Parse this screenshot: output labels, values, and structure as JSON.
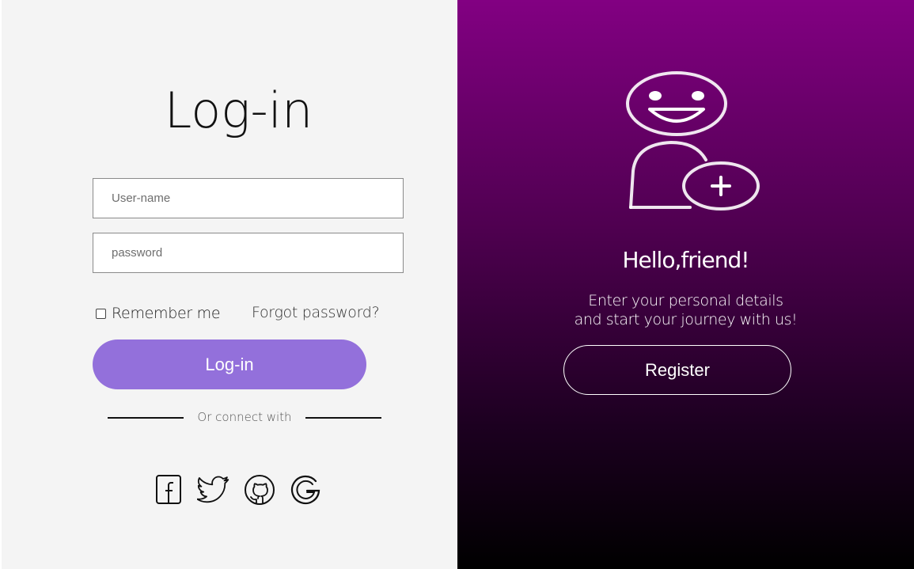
{
  "login": {
    "title": "Log-in",
    "username_placeholder": "User-name",
    "password_placeholder": "password",
    "remember_label": "Remember me",
    "forgot_label": "Forgot password?",
    "button_label": "Log-in",
    "connect_text": "Or connect with",
    "social_icons": [
      "facebook-icon",
      "twitter-icon",
      "github-icon",
      "google-icon"
    ],
    "button_color": "#9370db"
  },
  "welcome": {
    "icon": "add-user-icon",
    "title": "Hello,friend!",
    "text_line1": "Enter your personal details",
    "text_line2": "and start your journey with us!",
    "button_label": "Register",
    "gradient_top": "#820082",
    "gradient_bottom": "#000000"
  }
}
